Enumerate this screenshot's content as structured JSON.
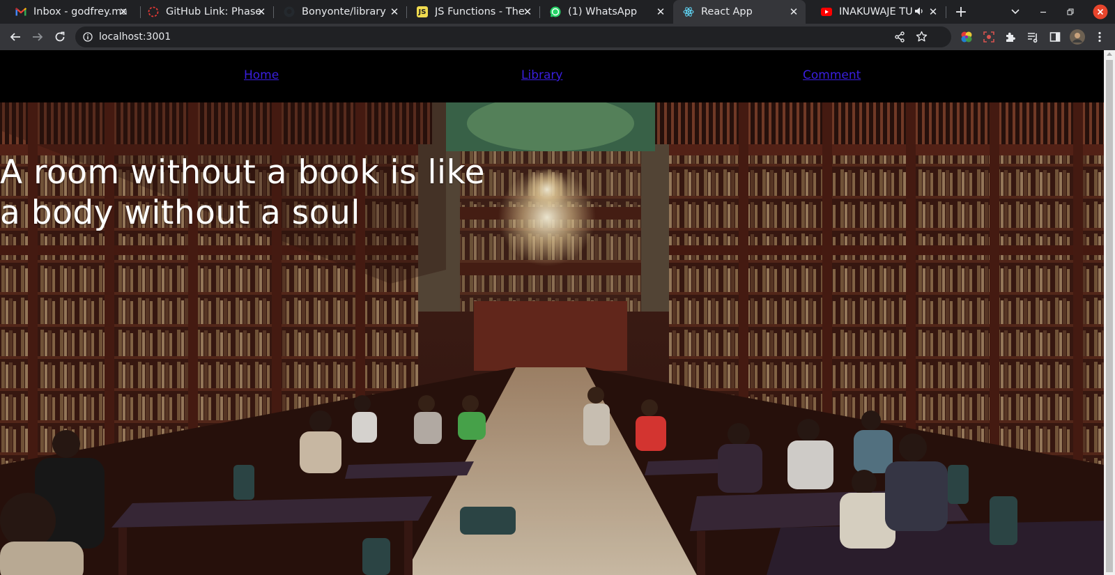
{
  "browser": {
    "tabs": [
      {
        "title": "Inbox - godfrey.ma",
        "favicon": "gmail-icon"
      },
      {
        "title": "GitHub Link: Phase",
        "favicon": "loading-icon"
      },
      {
        "title": "Bonyonte/library",
        "favicon": "github-icon"
      },
      {
        "title": "JS Functions - The",
        "favicon": "js-icon"
      },
      {
        "title": "(1) WhatsApp",
        "favicon": "whatsapp-icon"
      },
      {
        "title": "React App",
        "favicon": "react-icon",
        "active": true
      },
      {
        "title": "INAKUWAJE TU",
        "favicon": "youtube-icon",
        "audio": true
      }
    ],
    "url": "localhost:3001"
  },
  "page": {
    "nav": {
      "home": "Home",
      "library": "Library",
      "comment": "Comment"
    },
    "hero": {
      "line1": "A room without a book is like",
      "line2": "a body without a soul"
    }
  },
  "colors": {
    "link": "#3a1fe0",
    "chrome_dark": "#202124",
    "chrome_toolbar": "#35363a"
  }
}
